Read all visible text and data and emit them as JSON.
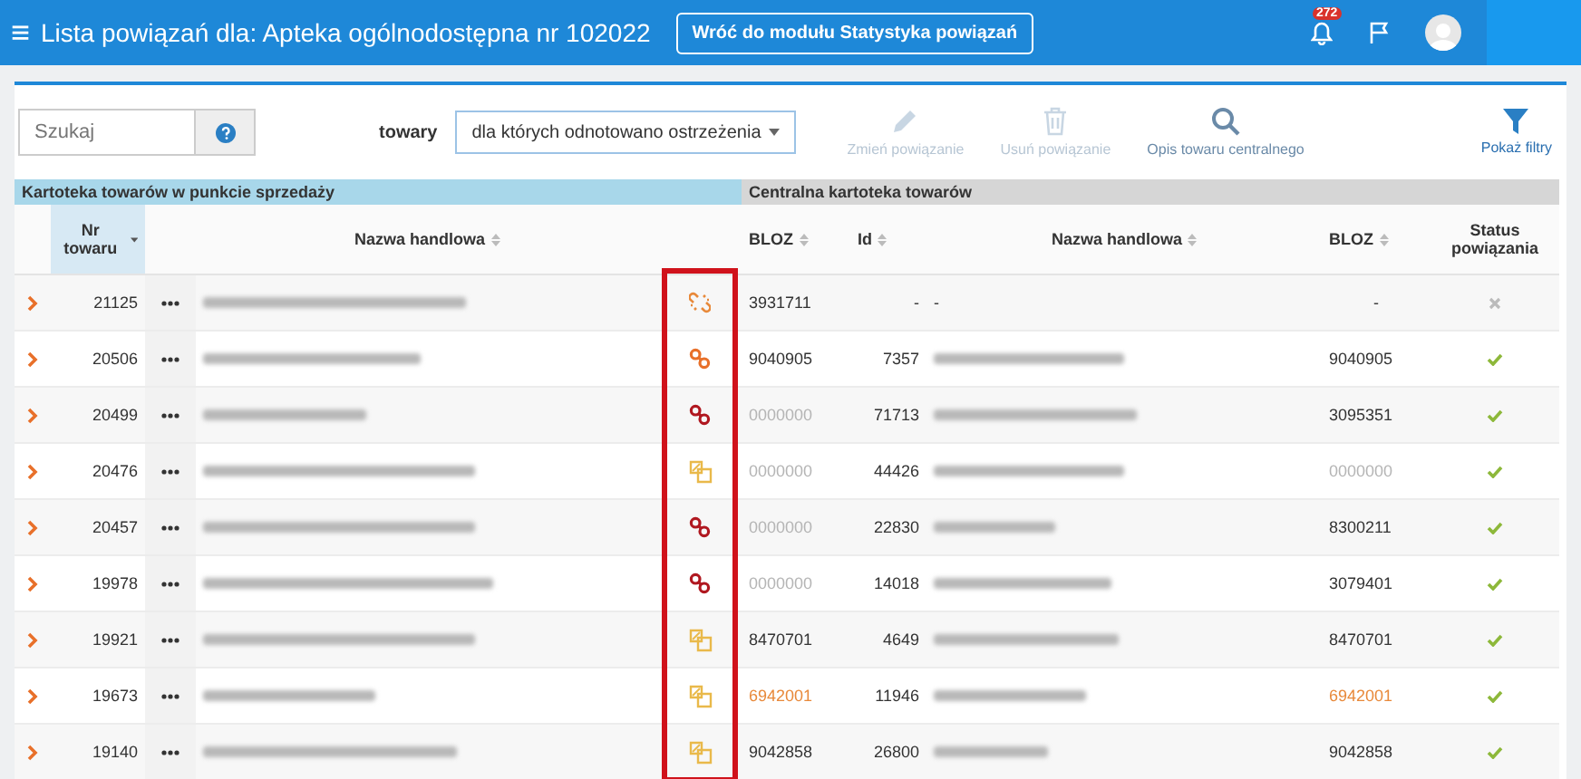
{
  "header": {
    "menu_icon": "≡",
    "title": "Lista powiązań dla: Apteka ogólnodostępna nr 102022",
    "back_button": "Wróć do modułu Statystyka powiązań",
    "notification_count": "272"
  },
  "toolbar": {
    "search": {
      "placeholder": "Szukaj"
    },
    "filter_label": "towary",
    "filter_value": "dla których odnotowano ostrzeżenia",
    "actions": [
      {
        "kind": "edit",
        "label": "Zmień powiązanie",
        "disabled": true
      },
      {
        "kind": "delete",
        "label": "Usuń powiązanie",
        "disabled": true
      },
      {
        "kind": "search",
        "label": "Opis towaru centralnego",
        "disabled": false
      }
    ],
    "filters_button": "Pokaż filtry"
  },
  "table": {
    "groups": [
      "Kartoteka towarów w punkcie sprzedaży",
      "Centralna kartoteka towarów"
    ],
    "columns": [
      "Nr towaru",
      "Nazwa handlowa",
      "BLOZ",
      "Id",
      "Nazwa handlowa",
      "BLOZ",
      "Status powiązania"
    ],
    "rows": [
      {
        "nr": "21125",
        "link": {
          "kind": "broken"
        },
        "bloz": {
          "text": "3931711",
          "kind": "normal"
        },
        "id": "-",
        "central_name": "-",
        "central_bloz": {
          "text": "-",
          "kind": "normal"
        },
        "linked": false
      },
      {
        "nr": "20506",
        "link": {
          "kind": "orange"
        },
        "bloz": {
          "text": "9040905",
          "kind": "normal"
        },
        "id": "7357",
        "central_bloz": {
          "text": "9040905",
          "kind": "normal"
        },
        "linked": true
      },
      {
        "nr": "20499",
        "link": {
          "kind": "red"
        },
        "bloz": {
          "text": "0000000",
          "kind": "muted"
        },
        "id": "71713",
        "central_bloz": {
          "text": "3095351",
          "kind": "normal"
        },
        "linked": true
      },
      {
        "nr": "20476",
        "link": {
          "kind": "copy"
        },
        "bloz": {
          "text": "0000000",
          "kind": "muted"
        },
        "id": "44426",
        "central_bloz": {
          "text": "0000000",
          "kind": "muted"
        },
        "linked": true
      },
      {
        "nr": "20457",
        "link": {
          "kind": "red"
        },
        "bloz": {
          "text": "0000000",
          "kind": "muted"
        },
        "id": "22830",
        "central_bloz": {
          "text": "8300211",
          "kind": "normal"
        },
        "linked": true
      },
      {
        "nr": "19978",
        "link": {
          "kind": "red"
        },
        "bloz": {
          "text": "0000000",
          "kind": "muted"
        },
        "id": "14018",
        "central_bloz": {
          "text": "3079401",
          "kind": "normal"
        },
        "linked": true
      },
      {
        "nr": "19921",
        "link": {
          "kind": "copy"
        },
        "bloz": {
          "text": "8470701",
          "kind": "normal"
        },
        "id": "4649",
        "central_bloz": {
          "text": "8470701",
          "kind": "normal"
        },
        "linked": true
      },
      {
        "nr": "19673",
        "link": {
          "kind": "copy"
        },
        "bloz": {
          "text": "6942001",
          "kind": "warn"
        },
        "id": "11946",
        "central_bloz": {
          "text": "6942001",
          "kind": "warn"
        },
        "linked": true
      },
      {
        "nr": "19140",
        "link": {
          "kind": "copy"
        },
        "bloz": {
          "text": "9042858",
          "kind": "normal"
        },
        "id": "26800",
        "central_bloz": {
          "text": "9042858",
          "kind": "normal"
        },
        "linked": true
      }
    ]
  }
}
